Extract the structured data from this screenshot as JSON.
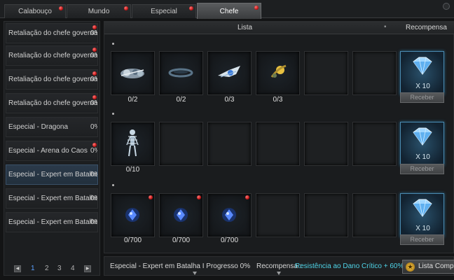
{
  "tabs": [
    {
      "label": "Calabouço"
    },
    {
      "label": "Mundo"
    },
    {
      "label": "Especial"
    },
    {
      "label": "Chefe"
    }
  ],
  "left_list": [
    {
      "name": "Retaliação do chefe governador I",
      "pct": "0%"
    },
    {
      "name": "Retaliação do chefe governador II",
      "pct": "0%"
    },
    {
      "name": "Retaliação do chefe governador III",
      "pct": "0%"
    },
    {
      "name": "Retaliação do chefe governador IV",
      "pct": "0%"
    },
    {
      "name": "Especial - Dragona",
      "pct": "0%"
    },
    {
      "name": "Especial - Arena do Caos",
      "pct": "0%"
    },
    {
      "name": "Especial - Expert em Batalha I",
      "pct": "0%"
    },
    {
      "name": "Especial - Expert em Batalha II",
      "pct": "0%"
    },
    {
      "name": "Especial - Expert em Batalha III",
      "pct": "0%"
    }
  ],
  "pager": {
    "pages": [
      "1",
      "2",
      "3",
      "4"
    ],
    "current": "1"
  },
  "header": {
    "list_label": "Lista",
    "reward_label": "Recompensa"
  },
  "rows": [
    {
      "slots": [
        {
          "count": "0/2",
          "icon": "silver-ornament-icon"
        },
        {
          "count": "0/2",
          "icon": "dark-ring-icon"
        },
        {
          "count": "0/3",
          "icon": "winged-gem-icon"
        },
        {
          "count": "0/3",
          "icon": "golden-orb-icon"
        }
      ],
      "reward_qty": "X 10",
      "reward_button": "Receber"
    },
    {
      "slots": [
        {
          "count": "0/10",
          "icon": "skeleton-figure-icon"
        }
      ],
      "reward_qty": "X 10",
      "reward_button": "Receber"
    },
    {
      "slots": [
        {
          "count": "0/700",
          "icon": "blue-crystal-icon"
        },
        {
          "count": "0/700",
          "icon": "blue-crystal-icon"
        },
        {
          "count": "0/700",
          "icon": "blue-crystal-icon"
        }
      ],
      "reward_qty": "X 10",
      "reward_button": "Receber"
    }
  ],
  "footer": {
    "progress_text": "Especial - Expert em Batalha I Progresso 0%",
    "reward_label": "Recompensa :",
    "reward_value": "Resistência ao Dano Crítico + 60%",
    "button_label": "Lista Completa"
  },
  "colors": {
    "reward_value": "#4fd4e8",
    "accent_blue": "#5aa0ff",
    "alert_dot": "#e02020"
  }
}
